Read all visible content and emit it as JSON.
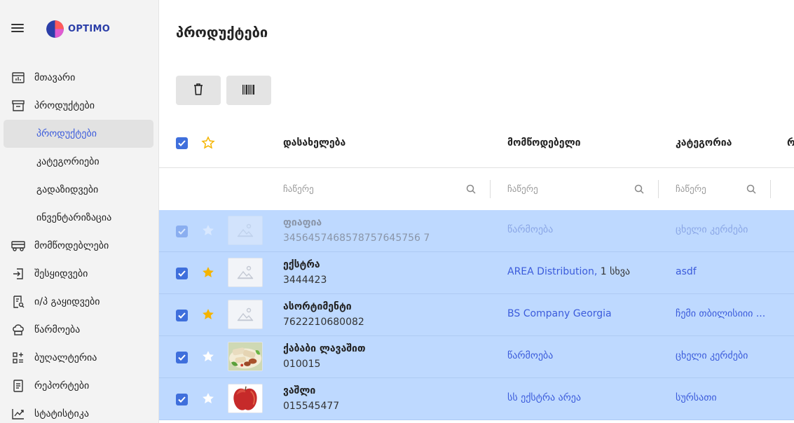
{
  "app": {
    "logo_text": "OPTIMO"
  },
  "sidebar": {
    "items": [
      {
        "label": "მთავარი",
        "icon": "dashboard-icon"
      },
      {
        "label": "პროდუქტები",
        "icon": "archive-box-icon"
      },
      {
        "label": "პროდუქტები",
        "sub": true,
        "active": true
      },
      {
        "label": "კატეგორიები",
        "sub": true
      },
      {
        "label": "გადაზიდვები",
        "sub": true
      },
      {
        "label": "ინვენტარიზაცია",
        "sub": true
      },
      {
        "label": "მომწოდებლები",
        "icon": "truck-icon"
      },
      {
        "label": "შესყიდვები",
        "icon": "import-icon"
      },
      {
        "label": "ი/პ გაყიდვები",
        "icon": "receipt-search-icon"
      },
      {
        "label": "წარმოება",
        "icon": "chef-hat-icon"
      },
      {
        "label": "ბუღალტერია",
        "icon": "calculator-icon"
      },
      {
        "label": "რეპორტები",
        "icon": "document-icon"
      },
      {
        "label": "სტატისტიკა",
        "icon": "chart-line-icon"
      }
    ]
  },
  "main": {
    "title": "პროდუქტები",
    "toolbar": {
      "delete_icon": "trash-icon",
      "barcode_icon": "barcode-icon"
    },
    "columns": {
      "name": "დასახელება",
      "supplier": "მომწოდებელი",
      "category": "კატეგორია",
      "next": "რ"
    },
    "filter_placeholder": "ჩაწერე",
    "rows": [
      {
        "name": "ფიაფია",
        "code": "3456457468578757645756 7",
        "supplier": "წარმოება",
        "supplier_extra": "",
        "category": "ცხელი კერძები",
        "starred": false,
        "image": "placeholder",
        "faded": true
      },
      {
        "name": "ექსტრა",
        "code": "3444423",
        "supplier": "AREA Distribution,",
        "supplier_extra": " 1 სხვა",
        "category": "asdf",
        "starred": true,
        "image": "placeholder",
        "faded": false
      },
      {
        "name": "ასორტიმენტი",
        "code": "7622210680082",
        "supplier": "BS Company Georgia",
        "supplier_extra": "",
        "category": "ჩემი თბილისიიი ...",
        "starred": true,
        "image": "placeholder",
        "faded": false
      },
      {
        "name": "ქაბაბი ლავაშით",
        "code": "010015",
        "supplier": "წარმოება",
        "supplier_extra": "",
        "category": "ცხელი კერძები",
        "starred": false,
        "image": "kebab-photo",
        "faded": false
      },
      {
        "name": "ვაშლი",
        "code": "015545477",
        "supplier": "სს ექსტრა არეა",
        "supplier_extra": "",
        "category": "სურსათი",
        "starred": false,
        "image": "apple-photo",
        "faded": false
      }
    ]
  },
  "colors": {
    "accent": "#3b5bdb",
    "checkbox": "#3f6fdc",
    "selected_row": "#bed9ff",
    "star": "#f5b400",
    "sidebar_bg": "#f3f3f3"
  }
}
